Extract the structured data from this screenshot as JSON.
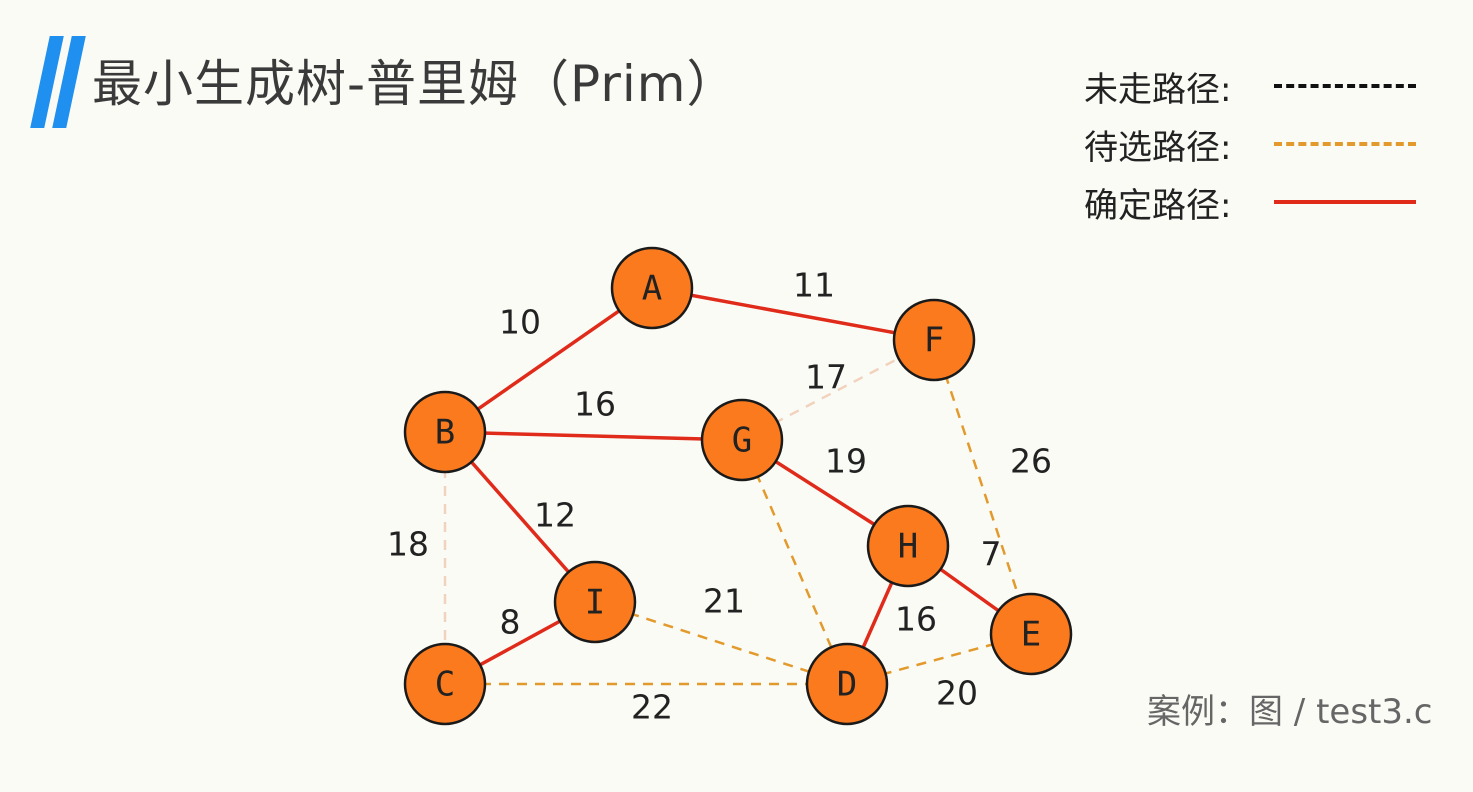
{
  "title": "最小生成树-普里姆（Prim）",
  "legend": {
    "unvisited": "未走路径:",
    "candidate": "待选路径:",
    "confirmed": "确定路径:"
  },
  "caption": "案例：图 / test3.c",
  "colors": {
    "accent": "#1f8ff0",
    "node_fill": "#fb7a1e",
    "confirmed": "#e02b1b",
    "candidate": "#e39a2c",
    "unvisited": "#111111"
  },
  "graph": {
    "nodes": [
      "A",
      "B",
      "C",
      "D",
      "E",
      "F",
      "G",
      "H",
      "I"
    ],
    "edges": [
      {
        "from": "A",
        "to": "B",
        "weight": "10",
        "status": "confirmed"
      },
      {
        "from": "A",
        "to": "F",
        "weight": "11",
        "status": "confirmed"
      },
      {
        "from": "B",
        "to": "G",
        "weight": "16",
        "status": "confirmed"
      },
      {
        "from": "B",
        "to": "I",
        "weight": "12",
        "status": "confirmed"
      },
      {
        "from": "B",
        "to": "C",
        "weight": "18",
        "status": "faded"
      },
      {
        "from": "C",
        "to": "I",
        "weight": "8",
        "status": "confirmed"
      },
      {
        "from": "C",
        "to": "D",
        "weight": "22",
        "status": "candidate"
      },
      {
        "from": "I",
        "to": "D",
        "weight": "21",
        "status": "candidate"
      },
      {
        "from": "G",
        "to": "F",
        "weight": "17",
        "status": "faded"
      },
      {
        "from": "G",
        "to": "H",
        "weight": "19",
        "status": "confirmed"
      },
      {
        "from": "G",
        "to": "D",
        "weight": "",
        "status": "candidate"
      },
      {
        "from": "F",
        "to": "E",
        "weight": "26",
        "status": "candidate"
      },
      {
        "from": "H",
        "to": "E",
        "weight": "7",
        "status": "confirmed"
      },
      {
        "from": "H",
        "to": "D",
        "weight": "16",
        "status": "confirmed"
      },
      {
        "from": "D",
        "to": "E",
        "weight": "20",
        "status": "candidate"
      }
    ]
  }
}
